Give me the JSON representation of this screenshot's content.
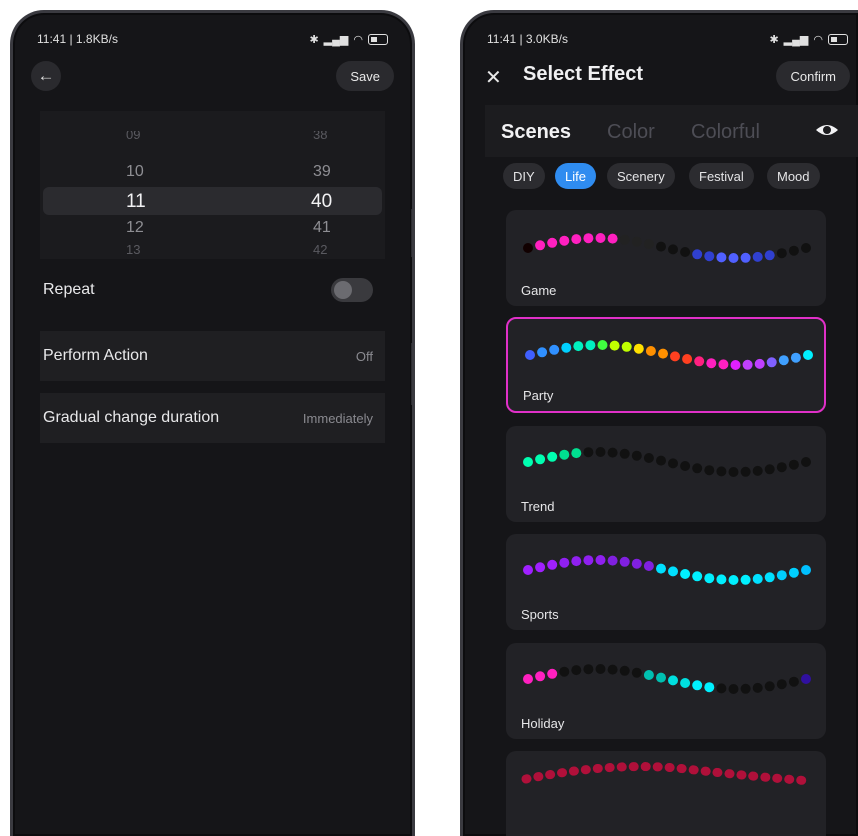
{
  "left": {
    "status": {
      "text": "11:41 | 1.8KB/s"
    },
    "header": {
      "save_label": "Save"
    },
    "picker": {
      "hours": [
        "09",
        "10",
        "11",
        "12",
        "13"
      ],
      "minutes": [
        "38",
        "39",
        "40",
        "41",
        "42"
      ]
    },
    "repeat": {
      "label": "Repeat"
    },
    "perform_action": {
      "label": "Perform Action",
      "value": "Off"
    },
    "gradual_change": {
      "label": "Gradual change duration",
      "value": "Immediately"
    }
  },
  "right": {
    "status": {
      "text": "11:41 | 3.0KB/s"
    },
    "header": {
      "title": "Select Effect",
      "confirm_label": "Confirm"
    },
    "tabs": [
      "Scenes",
      "Color",
      "Colorful"
    ],
    "chips": [
      "DIY",
      "Life",
      "Scenery",
      "Festival",
      "Mood"
    ],
    "effects": [
      {
        "label": "Game",
        "selected": false
      },
      {
        "label": "Party",
        "selected": true
      },
      {
        "label": "Trend",
        "selected": false
      },
      {
        "label": "Sports",
        "selected": false
      },
      {
        "label": "Holiday",
        "selected": false
      }
    ]
  },
  "colors": {
    "accent": "#2f8cf0",
    "selection_border": "#e030c8",
    "background": "#151518"
  }
}
